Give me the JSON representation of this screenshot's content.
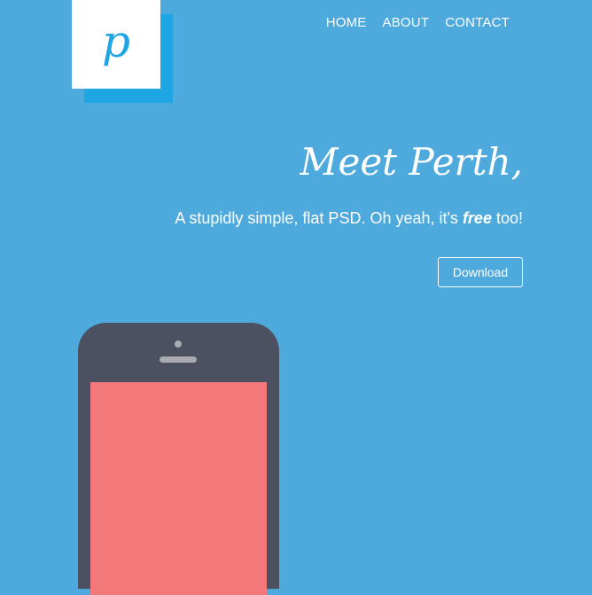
{
  "logo": {
    "letter": "p"
  },
  "nav": {
    "items": [
      {
        "label": "HOME"
      },
      {
        "label": "ABOUT"
      },
      {
        "label": "CONTACT"
      }
    ]
  },
  "hero": {
    "title": "Meet Perth,",
    "subtitle_before": "A stupidly simple, flat PSD. Oh yeah, it's ",
    "subtitle_emphasis": "free",
    "subtitle_after": " too!",
    "download_label": "Download"
  },
  "colors": {
    "background": "#4eaadc",
    "logo_accent": "#1ea5e3",
    "phone_body": "#4b5161",
    "phone_screen": "#f2787a"
  }
}
